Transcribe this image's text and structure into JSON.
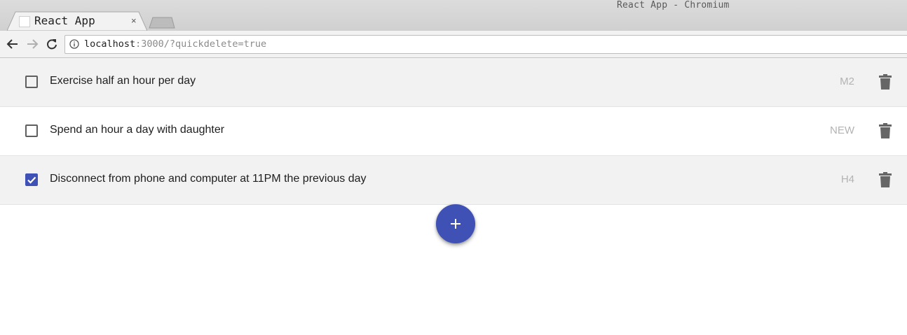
{
  "window": {
    "title": "React App - Chromium"
  },
  "tabs": [
    {
      "label": "React App",
      "close_glyph": "×",
      "icon": "favicon-blank"
    }
  ],
  "toolbar": {
    "url_host": "localhost",
    "url_rest": ":3000/?quickdelete=true",
    "icons": [
      "back-arrow-icon",
      "forward-arrow-icon",
      "reload-icon",
      "info-icon"
    ]
  },
  "todos": [
    {
      "text": "Exercise half an hour per day",
      "tag": "M2",
      "checked": false
    },
    {
      "text": "Spend an hour a day with daughter",
      "tag": "NEW",
      "checked": false
    },
    {
      "text": "Disconnect from phone and computer at 11PM the previous day",
      "tag": "H4",
      "checked": true
    }
  ],
  "colors": {
    "accent": "#3f51b5",
    "row_shaded": "#f2f2f2",
    "tag_text": "#b3b3b3",
    "icon_gray": "#666666"
  },
  "fab": {
    "icon": "plus-icon"
  }
}
